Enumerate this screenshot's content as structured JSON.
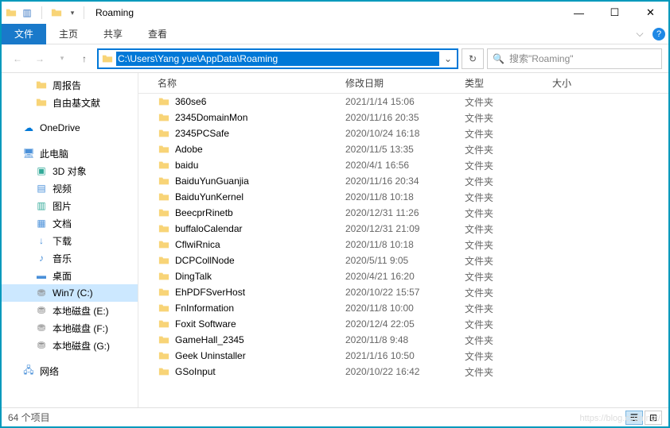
{
  "title": "Roaming",
  "ribbon": {
    "file": "文件",
    "home": "主页",
    "share": "共享",
    "view": "查看"
  },
  "nav": {
    "path": "C:\\Users\\Yang yue\\AppData\\Roaming",
    "search_placeholder": "搜索\"Roaming\""
  },
  "columns": {
    "name": "名称",
    "date": "修改日期",
    "type": "类型",
    "size": "大小"
  },
  "sidebar": {
    "quick": [
      {
        "label": "周报告",
        "icon": "folder"
      },
      {
        "label": "自由基文献",
        "icon": "folder"
      }
    ],
    "onedrive": "OneDrive",
    "thispc": "此电脑",
    "pc_items": [
      {
        "label": "3D 对象",
        "icon": "3d"
      },
      {
        "label": "视频",
        "icon": "video"
      },
      {
        "label": "图片",
        "icon": "pictures"
      },
      {
        "label": "文档",
        "icon": "documents"
      },
      {
        "label": "下载",
        "icon": "downloads"
      },
      {
        "label": "音乐",
        "icon": "music"
      },
      {
        "label": "桌面",
        "icon": "desktop"
      },
      {
        "label": "Win7 (C:)",
        "icon": "drive",
        "selected": true
      },
      {
        "label": "本地磁盘 (E:)",
        "icon": "drive"
      },
      {
        "label": "本地磁盘 (F:)",
        "icon": "drive"
      },
      {
        "label": "本地磁盘 (G:)",
        "icon": "drive"
      }
    ],
    "network": "网络"
  },
  "files": [
    {
      "name": "360se6",
      "date": "2021/1/14 15:06",
      "type": "文件夹"
    },
    {
      "name": "2345DomainMon",
      "date": "2020/11/16 20:35",
      "type": "文件夹"
    },
    {
      "name": "2345PCSafe",
      "date": "2020/10/24 16:18",
      "type": "文件夹"
    },
    {
      "name": "Adobe",
      "date": "2020/11/5 13:35",
      "type": "文件夹"
    },
    {
      "name": "baidu",
      "date": "2020/4/1 16:56",
      "type": "文件夹"
    },
    {
      "name": "BaiduYunGuanjia",
      "date": "2020/11/16 20:34",
      "type": "文件夹"
    },
    {
      "name": "BaiduYunKernel",
      "date": "2020/11/8 10:18",
      "type": "文件夹"
    },
    {
      "name": "BeecprRinetb",
      "date": "2020/12/31 11:26",
      "type": "文件夹"
    },
    {
      "name": "buffaloCalendar",
      "date": "2020/12/31 21:09",
      "type": "文件夹"
    },
    {
      "name": "CflwiRnica",
      "date": "2020/11/8 10:18",
      "type": "文件夹"
    },
    {
      "name": "DCPCollNode",
      "date": "2020/5/11 9:05",
      "type": "文件夹"
    },
    {
      "name": "DingTalk",
      "date": "2020/4/21 16:20",
      "type": "文件夹"
    },
    {
      "name": "EhPDFSverHost",
      "date": "2020/10/22 15:57",
      "type": "文件夹"
    },
    {
      "name": "FnInformation",
      "date": "2020/11/8 10:00",
      "type": "文件夹"
    },
    {
      "name": "Foxit Software",
      "date": "2020/12/4 22:05",
      "type": "文件夹"
    },
    {
      "name": "GameHall_2345",
      "date": "2020/11/8 9:48",
      "type": "文件夹"
    },
    {
      "name": "Geek Uninstaller",
      "date": "2021/1/16 10:50",
      "type": "文件夹"
    },
    {
      "name": "GSoInput",
      "date": "2020/10/22 16:42",
      "type": "文件夹"
    }
  ],
  "status": "64 个项目",
  "watermark": "https://blog.csdn.net/"
}
